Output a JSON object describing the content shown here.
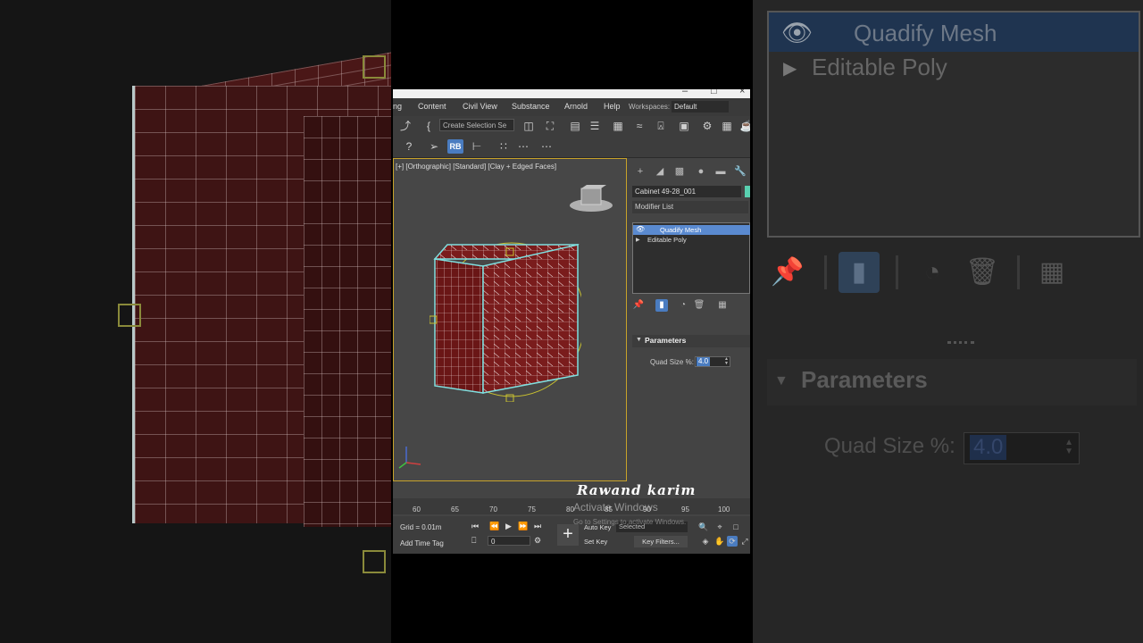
{
  "app": {
    "menu": [
      "ng",
      "Content",
      "Civil View",
      "Substance",
      "Arnold",
      "Help"
    ],
    "workspaces_label": "Workspaces:",
    "workspace_value": "Default",
    "selection_set_placeholder": "Create Selection Se",
    "rb_label": "RB",
    "viewport_label": "[+] [Orthographic] [Standard] [Clay + Edged Faces]",
    "object_name": "Cabinet 49-28_001",
    "modifier_list_label": "Modifier List",
    "stack": {
      "items": [
        {
          "label": "Quadify Mesh",
          "selected": true
        },
        {
          "label": "Editable Poly",
          "selected": false
        }
      ]
    },
    "parameters": {
      "title": "Parameters",
      "quad_size_label": "Quad Size %:",
      "quad_size_value": "4.0"
    },
    "timeline_ticks": [
      "60",
      "65",
      "70",
      "75",
      "80",
      "85",
      "90",
      "95",
      "100"
    ],
    "status": {
      "grid": "Grid = 0.01m",
      "add_time_tag": "Add Time Tag",
      "frame": "0",
      "auto_key": "Auto Key",
      "set_key": "Set Key",
      "selected": "Selected",
      "key_filters": "Key Filters..."
    },
    "watermark": "Rawand karim",
    "activate_windows": "Activate Windows",
    "activate_windows_hint": "Go to Settings to activate Windows."
  },
  "zoom_panel": {
    "stack_items": [
      "Quadify Mesh",
      "Editable Poly"
    ],
    "parameters_title": "Parameters",
    "quad_size_label": "Quad Size %:",
    "quad_size_value": "4.0"
  },
  "colors": {
    "selection_blue": "#5a8ad0",
    "viewport_border": "#c8a32a",
    "cabinet_red": "#7a1c1c",
    "wire_cyan": "#7fe0e0",
    "object_color": "#59d0b0"
  }
}
